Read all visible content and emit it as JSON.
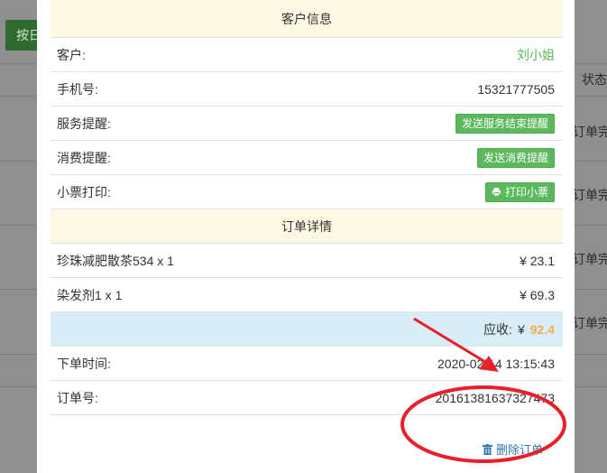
{
  "background": {
    "button_label": "按日",
    "header_label": "状态",
    "row_labels": [
      "订单完",
      "订单完",
      "订单完",
      "订单完"
    ]
  },
  "customer_section": {
    "title": "客户信息",
    "customer_label": "客户:",
    "customer_value": "刘小姐",
    "phone_label": "手机号:",
    "phone_value": "15321777505",
    "service_reminder_label": "服务提醒:",
    "service_reminder_button": "发送服务结束提醒",
    "consumption_reminder_label": "消费提醒:",
    "consumption_reminder_button": "发送消费提醒",
    "receipt_label": "小票打印:",
    "receipt_button": "打印小票"
  },
  "order_section": {
    "title": "订单详情",
    "items": [
      {
        "name": "珍珠减肥散茶534 x 1",
        "price": "¥ 23.1"
      },
      {
        "name": "染发剂1 x 1",
        "price": "¥ 69.3"
      }
    ],
    "total_label": "应收:",
    "total_currency": "¥",
    "total_value": "92.4",
    "time_label": "下单时间:",
    "time_value": "2020-02-14 13:15:43",
    "order_no_label": "订单号:",
    "order_no_value": "20161381637327473",
    "delete_label": "删除订单"
  },
  "colors": {
    "green": "#5cb85c",
    "total_orange": "#f0ad4e",
    "link_blue": "#337ab7",
    "annotation_red": "#e8202a"
  },
  "icons": {
    "print": "printer-icon",
    "delete": "trash-icon"
  }
}
